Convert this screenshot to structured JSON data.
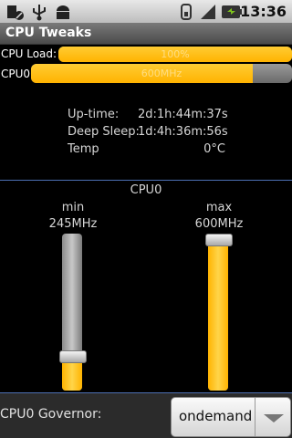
{
  "status": {
    "time": "13:36",
    "icons": [
      "usb-debug-icon",
      "usb-icon",
      "android-icon",
      "wifi-icon",
      "signal-icon",
      "battery-icon"
    ]
  },
  "title": "CPU Tweaks",
  "load": {
    "label": "CPU Load:",
    "value": 1.0,
    "text": "100%"
  },
  "cpu0_bar": {
    "label": "CPU0",
    "value": 0.85,
    "text": "600MHz"
  },
  "stats": {
    "uptime_label": "Up-time:",
    "uptime_value": "2d:1h:44m:37s",
    "deep_sleep_label": "Deep Sleep:",
    "deep_sleep_value": "1d:4h:36m:56s",
    "temp_label": "Temp",
    "temp_value": "0°C"
  },
  "section_title": "CPU0",
  "sliders": {
    "min_label": "min",
    "min_value": "245MHz",
    "min_level": 0.22,
    "max_label": "max",
    "max_value": "600MHz",
    "max_level": 1.0
  },
  "governor": {
    "label": "CPU0 Governor:",
    "value": "ondemand"
  },
  "colors": {
    "accent": "#ffb300",
    "rule": "#4d6fb3",
    "background": "#000000"
  }
}
